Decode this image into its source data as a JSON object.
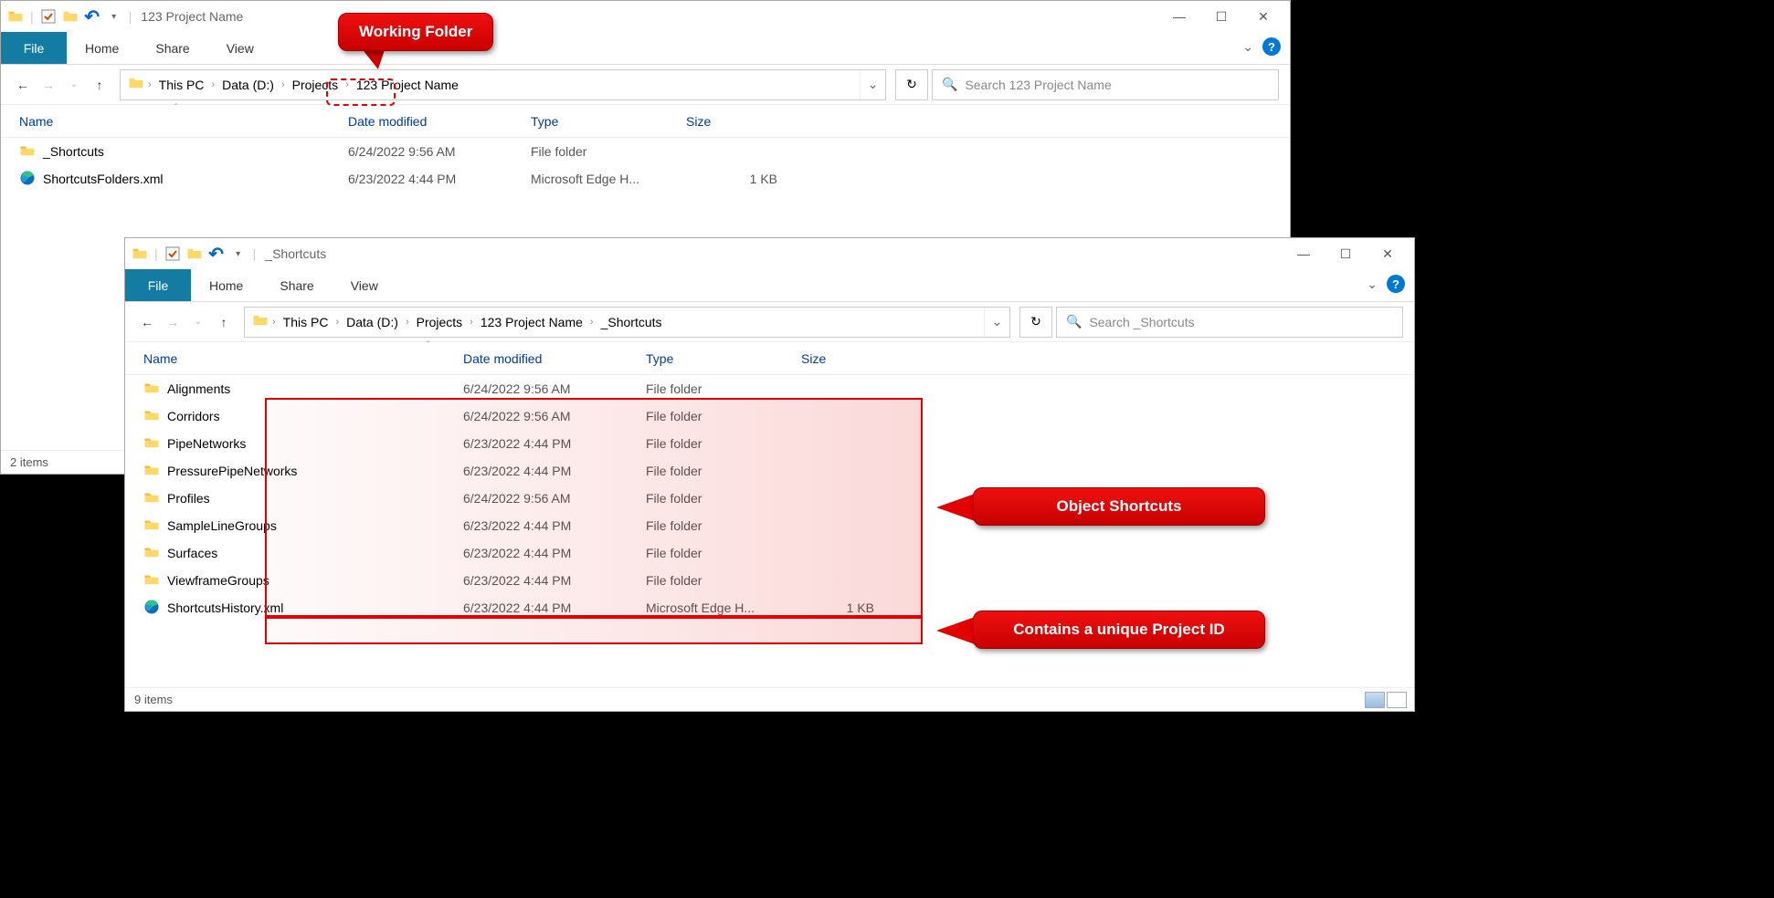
{
  "window1": {
    "title": "123 Project Name",
    "ribbon": {
      "file": "File",
      "home": "Home",
      "share": "Share",
      "view": "View"
    },
    "breadcrumb": [
      "This PC",
      "Data (D:)",
      "Projects",
      "123 Project Name"
    ],
    "search_placeholder": "Search 123 Project Name",
    "columns": {
      "name": "Name",
      "date": "Date modified",
      "type": "Type",
      "size": "Size"
    },
    "rows": [
      {
        "icon": "folder",
        "name": "_Shortcuts",
        "date": "6/24/2022 9:56 AM",
        "type": "File folder",
        "size": ""
      },
      {
        "icon": "edge",
        "name": "ShortcutsFolders.xml",
        "date": "6/23/2022 4:44 PM",
        "type": "Microsoft Edge H...",
        "size": "1 KB"
      }
    ],
    "status": "2 items"
  },
  "window2": {
    "title": "_Shortcuts",
    "ribbon": {
      "file": "File",
      "home": "Home",
      "share": "Share",
      "view": "View"
    },
    "breadcrumb": [
      "This PC",
      "Data (D:)",
      "Projects",
      "123 Project Name",
      "_Shortcuts"
    ],
    "search_placeholder": "Search _Shortcuts",
    "columns": {
      "name": "Name",
      "date": "Date modified",
      "type": "Type",
      "size": "Size"
    },
    "rows": [
      {
        "icon": "folder",
        "name": "Alignments",
        "date": "6/24/2022 9:56 AM",
        "type": "File folder",
        "size": ""
      },
      {
        "icon": "folder",
        "name": "Corridors",
        "date": "6/24/2022 9:56 AM",
        "type": "File folder",
        "size": ""
      },
      {
        "icon": "folder",
        "name": "PipeNetworks",
        "date": "6/23/2022 4:44 PM",
        "type": "File folder",
        "size": ""
      },
      {
        "icon": "folder",
        "name": "PressurePipeNetworks",
        "date": "6/23/2022 4:44 PM",
        "type": "File folder",
        "size": ""
      },
      {
        "icon": "folder",
        "name": "Profiles",
        "date": "6/24/2022 9:56 AM",
        "type": "File folder",
        "size": ""
      },
      {
        "icon": "folder",
        "name": "SampleLineGroups",
        "date": "6/23/2022 4:44 PM",
        "type": "File folder",
        "size": ""
      },
      {
        "icon": "folder",
        "name": "Surfaces",
        "date": "6/23/2022 4:44 PM",
        "type": "File folder",
        "size": ""
      },
      {
        "icon": "folder",
        "name": "ViewframeGroups",
        "date": "6/23/2022 4:44 PM",
        "type": "File folder",
        "size": ""
      },
      {
        "icon": "edge",
        "name": "ShortcutsHistory.xml",
        "date": "6/23/2022 4:44 PM",
        "type": "Microsoft Edge H...",
        "size": "1 KB"
      }
    ],
    "status": "9 items"
  },
  "callouts": {
    "working_folder": "Working Folder",
    "object_shortcuts": "Object Shortcuts",
    "project_id": "Contains a unique Project ID"
  }
}
